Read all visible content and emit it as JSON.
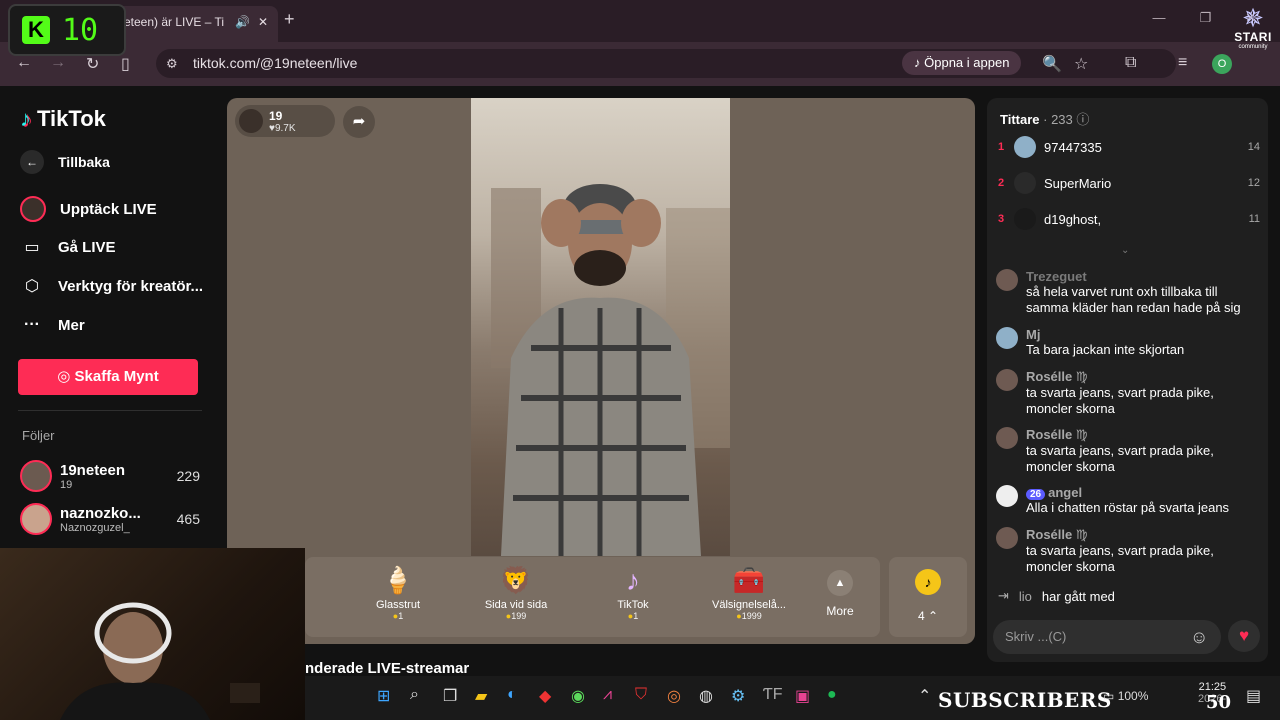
{
  "browser": {
    "tab_title": "eteen) är LIVE – Ti",
    "url": "tiktok.com/@19neteen/live",
    "open_in_app": "Öppna i appen",
    "profile_initial": "O"
  },
  "overlay": {
    "kick_letter": "K",
    "kick_count": "10",
    "stari_name": "STARI",
    "stari_sub": "community",
    "subscribers_label": "SUBSCRIBERS",
    "subscribers_count": "50"
  },
  "sidebar": {
    "logo": "TikTok",
    "back": "Tillbaka",
    "items": [
      {
        "label": "Upptäck LIVE",
        "icon": "live-discover-icon"
      },
      {
        "label": "Gå LIVE",
        "icon": "camera-icon"
      },
      {
        "label": "Verktyg för kreatör...",
        "icon": "creator-tools-icon"
      },
      {
        "label": "Mer",
        "icon": "more-dots-icon"
      }
    ],
    "coins_button": "Skaffa Mynt",
    "following_title": "Följer",
    "following": [
      {
        "name": "19neteen",
        "sub": "19",
        "count": "229"
      },
      {
        "name": "naznozko...",
        "sub": "Naznozguzel_",
        "count": "465"
      }
    ]
  },
  "player": {
    "host_name": "19",
    "host_likes": "9.7K",
    "gifts": [
      {
        "name": "Glasstrut",
        "price": "1",
        "icon": "🍦"
      },
      {
        "name": "Sida vid sida",
        "price": "199",
        "icon": "🦁"
      },
      {
        "name": "TikTok",
        "price": "1",
        "icon": "♪"
      },
      {
        "name": "Välsignelselå...",
        "price": "1999",
        "icon": "🧰"
      }
    ],
    "more_label": "More",
    "coin_balance": "4",
    "recommended_heading": "nderade LIVE-streamar"
  },
  "chat": {
    "viewers_title": "Tittare",
    "viewers_count": "· 233",
    "top_viewers": [
      {
        "rank": "1",
        "name": "97447335",
        "score": "14"
      },
      {
        "rank": "2",
        "name": "SuperMario",
        "score": "12"
      },
      {
        "rank": "3",
        "name": "d19ghost,",
        "score": "11"
      }
    ],
    "messages": [
      {
        "name": "Trezeguet",
        "text": "så hela varvet runt oxh tillbaka till samma kläder han redan hade på sig"
      },
      {
        "name": "Mj",
        "text": "Ta bara jackan inte skjortan"
      },
      {
        "name": "Rosélle ♍",
        "text": "ta svarta jeans, svart prada pike, moncler skorna"
      },
      {
        "name": "Rosélle ♍",
        "text": "ta svarta jeans, svart prada pike, moncler skorna"
      },
      {
        "name": "angel",
        "level": "26",
        "text": "Alla i chatten röstar på svarta jeans"
      },
      {
        "name": "Rosélle ♍",
        "text": "ta svarta jeans, svart prada pike, moncler skorna"
      }
    ],
    "joined_name": "lio",
    "joined_text": "har gått med",
    "input_placeholder": "Skriv ...(C)"
  },
  "taskbar": {
    "battery": "100%",
    "time": "21:25",
    "date": "2026-"
  },
  "colors": {
    "brand": "#fe2c55",
    "kick_green": "#53fc18",
    "coin": "#f5c518"
  }
}
